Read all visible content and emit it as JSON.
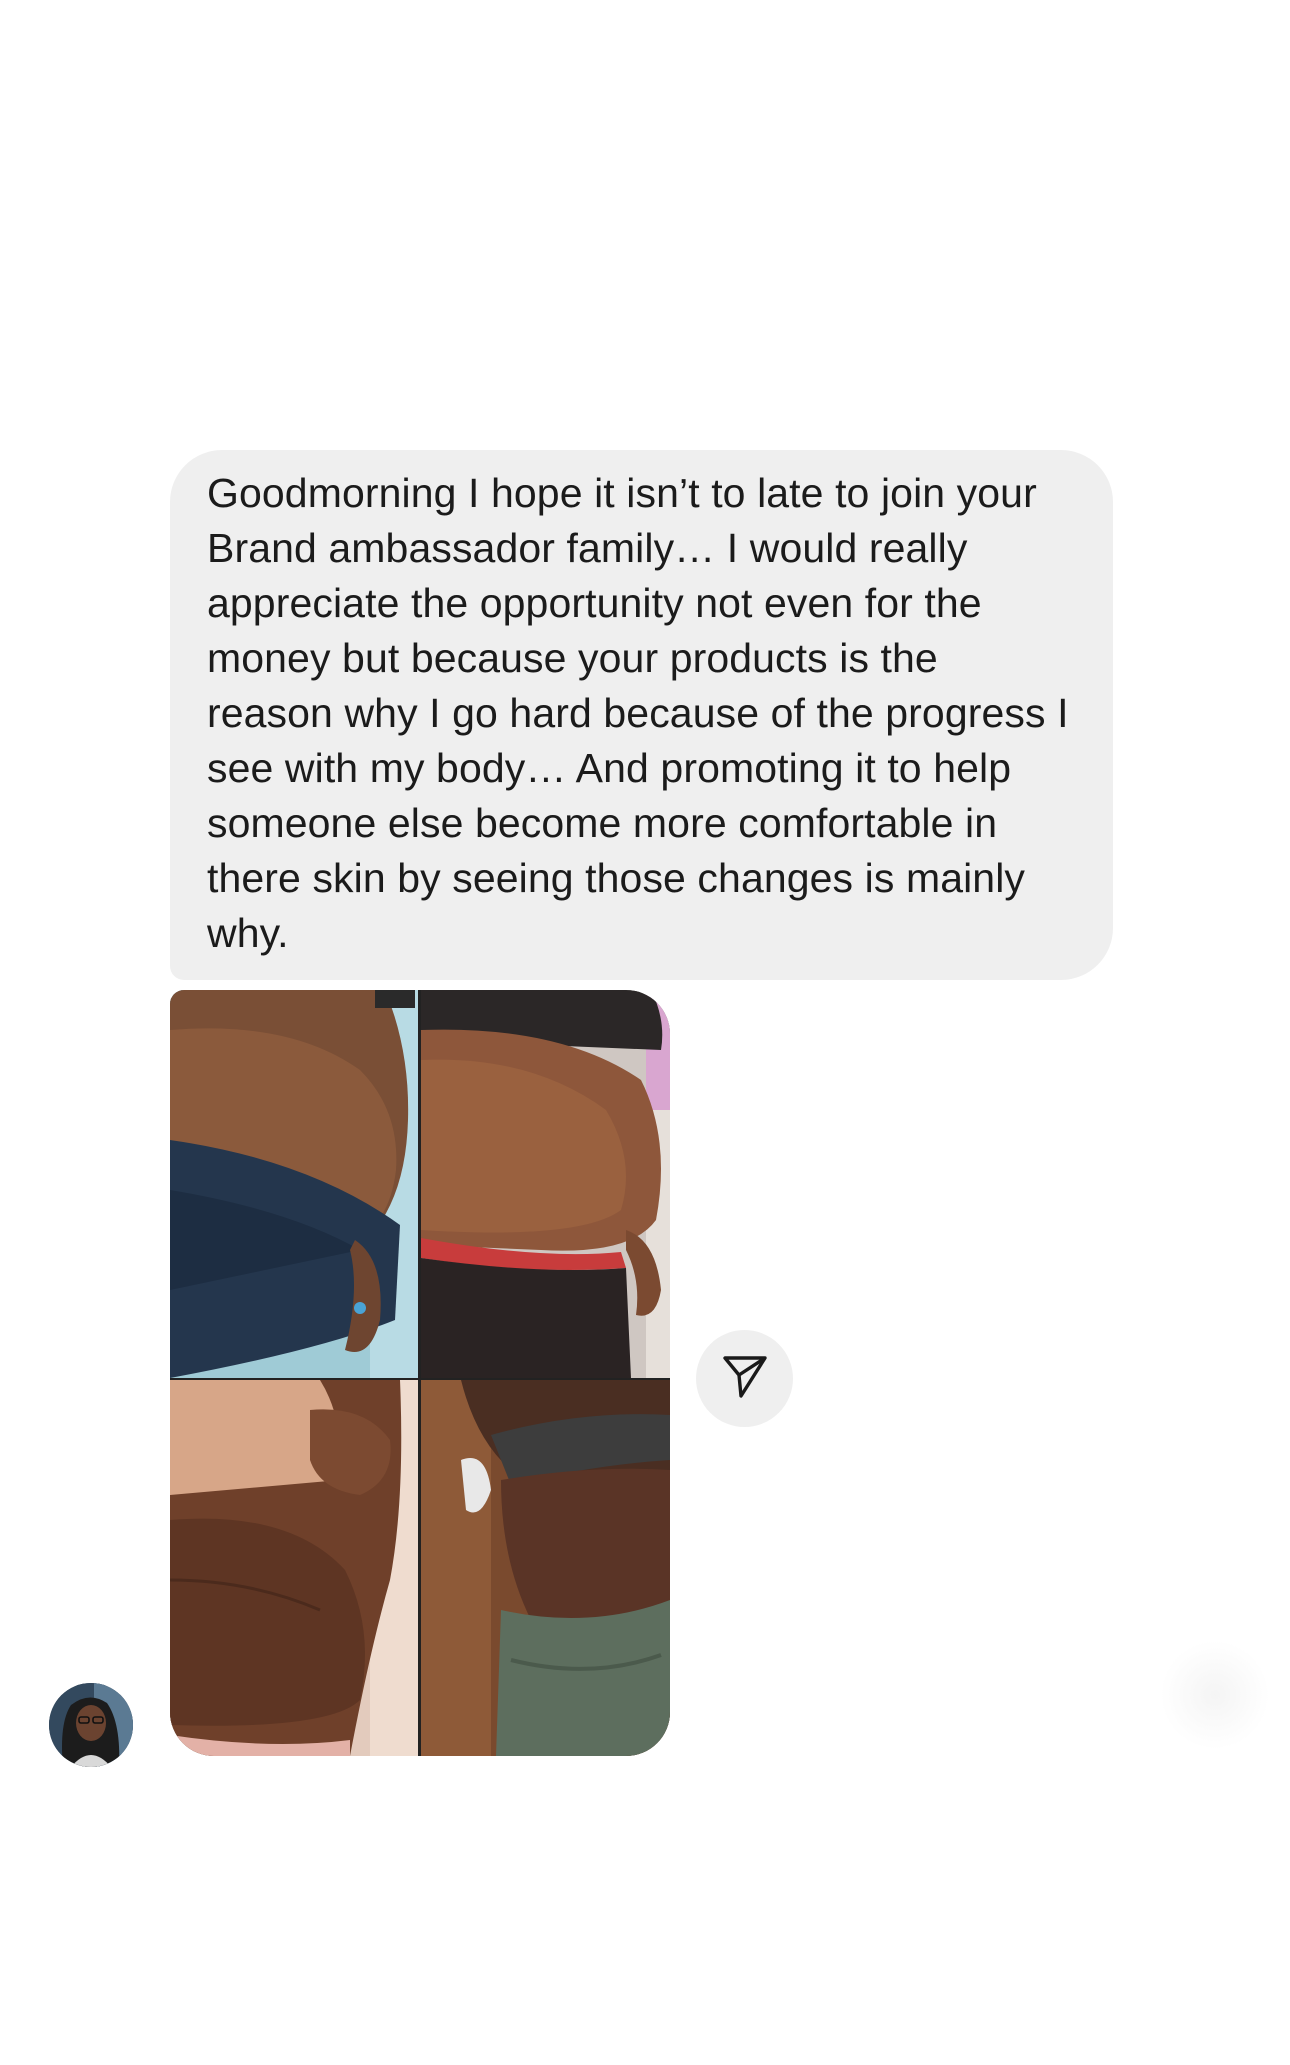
{
  "thread": {
    "message": {
      "text": "Goodmorning I hope it isn’t to late to join your Brand ambassador family… I would really appreciate the opportunity not even for the money but because your products is the reason why I go hard because of the progress I see with my body… And promoting it to help someone else become more comfortable in there skin by seeing those changes is mainly why."
    },
    "attachment": {
      "panels": [
        "top-left-photo",
        "top-right-photo",
        "bottom-left-photo",
        "bottom-right-photo"
      ]
    },
    "share_icon": "paper-plane-icon",
    "avatar_icon": "profile-avatar"
  },
  "colors": {
    "bubble": "#efefef",
    "text": "#1b1b1b",
    "background": "#ffffff"
  }
}
